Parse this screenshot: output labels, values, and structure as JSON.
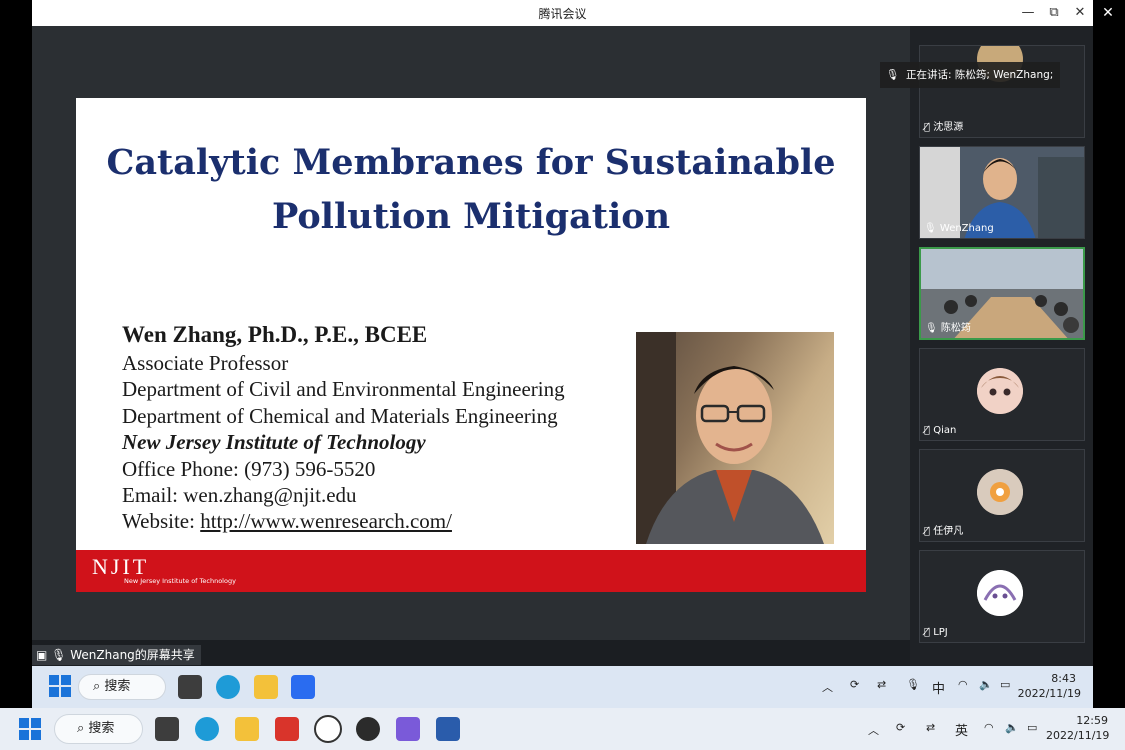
{
  "window": {
    "title": "腾讯会议",
    "minimize": "—",
    "restore": "⧉",
    "close": "✕",
    "outer_close": "✕"
  },
  "slide": {
    "title_line1": "Catalytic Membranes for Sustainable",
    "title_line2": "Pollution Mitigation",
    "name": "Wen Zhang, Ph.D., P.E., BCEE",
    "position": "Associate Professor",
    "dept1": "Department of Civil and Environmental Engineering",
    "dept2": "Department of Chemical and Materials Engineering",
    "institution": "New Jersey Institute of Technology",
    "phone": "Office Phone: (973) 596-5520",
    "email": "Email: wen.zhang@njit.edu",
    "website_label": "Website: ",
    "website_url": "http://www.wenresearch.com/",
    "logo_text": "NJIT",
    "logo_sub": "New Jersey Institute of Technology"
  },
  "share_label": "WenZhang的屏幕共享",
  "speaking": "正在讲话: 陈松筠; WenZhang;",
  "participants": [
    {
      "name": "沈思源",
      "mic": "muted"
    },
    {
      "name": "WenZhang",
      "mic": "on"
    },
    {
      "name": "陈松筠",
      "mic": "on",
      "active": true
    },
    {
      "name": "Qian",
      "mic": "muted"
    },
    {
      "name": "任伊凡",
      "mic": "muted"
    },
    {
      "name": "LPJ",
      "mic": "muted"
    }
  ],
  "inner_taskbar": {
    "search": "搜索",
    "ime": "中",
    "time": "8:43",
    "date": "2022/11/19"
  },
  "local_taskbar": {
    "search": "搜索",
    "ime": "英",
    "time": "12:59",
    "date": "2022/11/19"
  },
  "colors": {
    "slide_title": "#1b2f6e",
    "njit_red": "#d0121a",
    "active_border": "#3b9a4a"
  }
}
